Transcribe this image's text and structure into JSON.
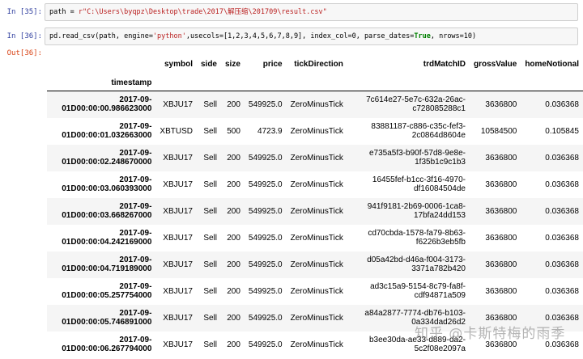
{
  "cell35": {
    "prompt": "In  [35]:",
    "code_prefix": "path = ",
    "code_string": "r\"C:\\Users\\byqpz\\Desktop\\trade\\2017\\解压缩\\201709\\result.csv\""
  },
  "cell36": {
    "prompt": "In  [36]:",
    "out_prompt": "Out[36]:",
    "code": {
      "p1": "pd.read_csv(path, engine=",
      "s1": "'python'",
      "p2": ",usecols=[1,2,3,4,5,6,7,8,9], index_col=0, parse_dates=",
      "k1": "True",
      "p3": ", nrows=10)"
    }
  },
  "table": {
    "columns": [
      "symbol",
      "side",
      "size",
      "price",
      "tickDirection",
      "trdMatchID",
      "grossValue",
      "homeNotional"
    ],
    "index_name": "timestamp",
    "rows": [
      {
        "ts1": "2017-09-",
        "ts2": "01D00:00:00.986623000",
        "symbol": "XBJU17",
        "side": "Sell",
        "size": "200",
        "price": "549925.0",
        "tick": "ZeroMinusTick",
        "id1": "7c614e27-5e7c-632a-26ac-",
        "id2": "c728085288c1",
        "gross": "3636800",
        "home": "0.036368"
      },
      {
        "ts1": "2017-09-",
        "ts2": "01D00:00:01.032663000",
        "symbol": "XBTUSD",
        "side": "Sell",
        "size": "500",
        "price": "4723.9",
        "tick": "ZeroMinusTick",
        "id1": "83881187-c886-c35c-fef3-",
        "id2": "2c0864d8604e",
        "gross": "10584500",
        "home": "0.105845"
      },
      {
        "ts1": "2017-09-",
        "ts2": "01D00:00:02.248670000",
        "symbol": "XBJU17",
        "side": "Sell",
        "size": "200",
        "price": "549925.0",
        "tick": "ZeroMinusTick",
        "id1": "e735a5f3-b90f-57d8-9e8e-",
        "id2": "1f35b1c9c1b3",
        "gross": "3636800",
        "home": "0.036368"
      },
      {
        "ts1": "2017-09-",
        "ts2": "01D00:00:03.060393000",
        "symbol": "XBJU17",
        "side": "Sell",
        "size": "200",
        "price": "549925.0",
        "tick": "ZeroMinusTick",
        "id1": "16455fef-b1cc-3f16-4970-",
        "id2": "df16084504de",
        "gross": "3636800",
        "home": "0.036368"
      },
      {
        "ts1": "2017-09-",
        "ts2": "01D00:00:03.668267000",
        "symbol": "XBJU17",
        "side": "Sell",
        "size": "200",
        "price": "549925.0",
        "tick": "ZeroMinusTick",
        "id1": "941f9181-2b69-0006-1ca8-",
        "id2": "17bfa24dd153",
        "gross": "3636800",
        "home": "0.036368"
      },
      {
        "ts1": "2017-09-",
        "ts2": "01D00:00:04.242169000",
        "symbol": "XBJU17",
        "side": "Sell",
        "size": "200",
        "price": "549925.0",
        "tick": "ZeroMinusTick",
        "id1": "cd70cbda-1578-fa79-8b63-",
        "id2": "f6226b3eb5fb",
        "gross": "3636800",
        "home": "0.036368"
      },
      {
        "ts1": "2017-09-",
        "ts2": "01D00:00:04.719189000",
        "symbol": "XBJU17",
        "side": "Sell",
        "size": "200",
        "price": "549925.0",
        "tick": "ZeroMinusTick",
        "id1": "d05a42bd-d46a-f004-3173-",
        "id2": "3371a782b420",
        "gross": "3636800",
        "home": "0.036368"
      },
      {
        "ts1": "2017-09-",
        "ts2": "01D00:00:05.257754000",
        "symbol": "XBJU17",
        "side": "Sell",
        "size": "200",
        "price": "549925.0",
        "tick": "ZeroMinusTick",
        "id1": "ad3c15a9-5154-8c79-fa8f-",
        "id2": "cdf94871a509",
        "gross": "3636800",
        "home": "0.036368"
      },
      {
        "ts1": "2017-09-",
        "ts2": "01D00:00:05.746891000",
        "symbol": "XBJU17",
        "side": "Sell",
        "size": "200",
        "price": "549925.0",
        "tick": "ZeroMinusTick",
        "id1": "a84a2877-7774-db76-b103-",
        "id2": "0a334dad26d2",
        "gross": "3636800",
        "home": "0.036368"
      },
      {
        "ts1": "2017-09-",
        "ts2": "01D00:00:06.267794000",
        "symbol": "XBJU17",
        "side": "Sell",
        "size": "200",
        "price": "549925.0",
        "tick": "ZeroMinusTick",
        "id1": "b3ee30da-ae33-d889-da2-",
        "id2": "5c2f08e2097a",
        "gross": "3636800",
        "home": "0.036368"
      }
    ]
  },
  "watermark": "知乎 @卡斯特梅的雨季",
  "colors": {
    "in_prompt": "#303f9f",
    "out_prompt": "#d84315",
    "string": "#ba2121",
    "keyword": "#008000",
    "stripe": "#f5f5f5"
  }
}
